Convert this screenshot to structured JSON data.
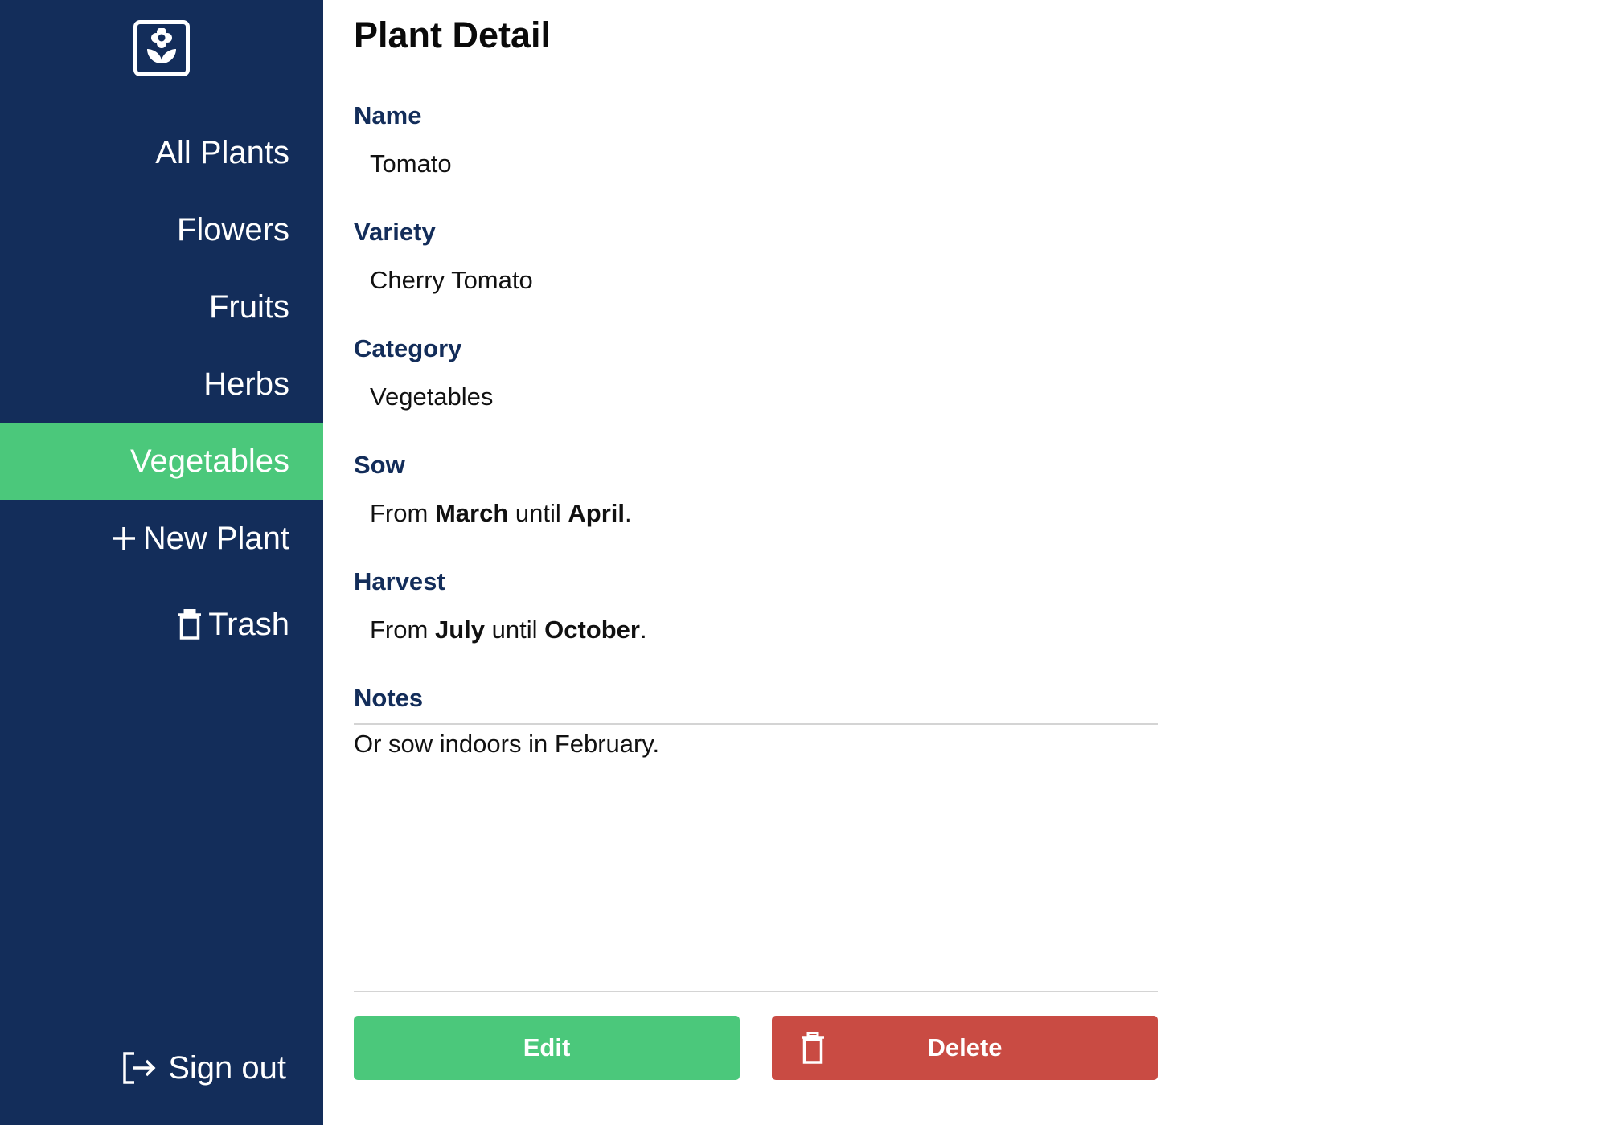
{
  "sidebar": {
    "logo_icon": "flower-icon",
    "items": [
      {
        "label": "All Plants",
        "active": false
      },
      {
        "label": "Flowers",
        "active": false
      },
      {
        "label": "Fruits",
        "active": false
      },
      {
        "label": "Herbs",
        "active": false
      },
      {
        "label": "Vegetables",
        "active": true
      }
    ],
    "new_plant_label": "New Plant",
    "trash_label": "Trash",
    "sign_out_label": "Sign out"
  },
  "main": {
    "title": "Plant Detail",
    "fields": {
      "name": {
        "label": "Name",
        "value": "Tomato"
      },
      "variety": {
        "label": "Variety",
        "value": "Cherry Tomato"
      },
      "category": {
        "label": "Category",
        "value": "Vegetables"
      },
      "sow": {
        "label": "Sow",
        "prefix": "From",
        "from": "March",
        "middle": "until",
        "until": "April",
        "suffix": "."
      },
      "harvest": {
        "label": "Harvest",
        "prefix": "From",
        "from": "July",
        "middle": "until",
        "until": "October",
        "suffix": "."
      },
      "notes": {
        "label": "Notes",
        "value": "Or sow indoors in February."
      }
    },
    "buttons": {
      "edit_label": "Edit",
      "delete_label": "Delete"
    }
  },
  "colors": {
    "sidebar_bg": "#132d5a",
    "accent_green": "#4bc87b",
    "danger_red": "#c94b43",
    "label_navy": "#132d5a"
  }
}
